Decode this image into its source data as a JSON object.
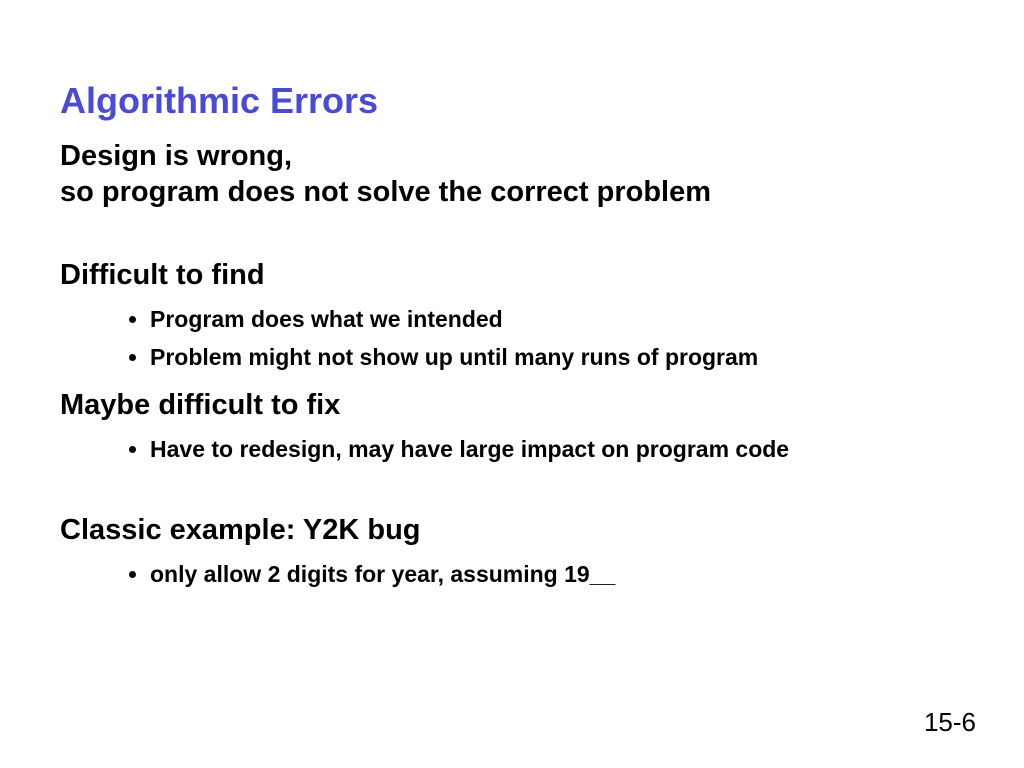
{
  "title": "Algorithmic Errors",
  "subtitle_line1": "Design is wrong,",
  "subtitle_line2": "so program does not solve the correct problem",
  "section1": {
    "heading": "Difficult to find",
    "bullets": [
      "Program does what we intended",
      "Problem might not show up until many runs of program"
    ]
  },
  "section2": {
    "heading": "Maybe difficult to fix",
    "bullets": [
      "Have to redesign, may have large impact on program code"
    ]
  },
  "section3": {
    "heading": "Classic example: Y2K bug",
    "bullets": [
      "only allow 2 digits for year, assuming 19__"
    ]
  },
  "page_number": "15-6"
}
